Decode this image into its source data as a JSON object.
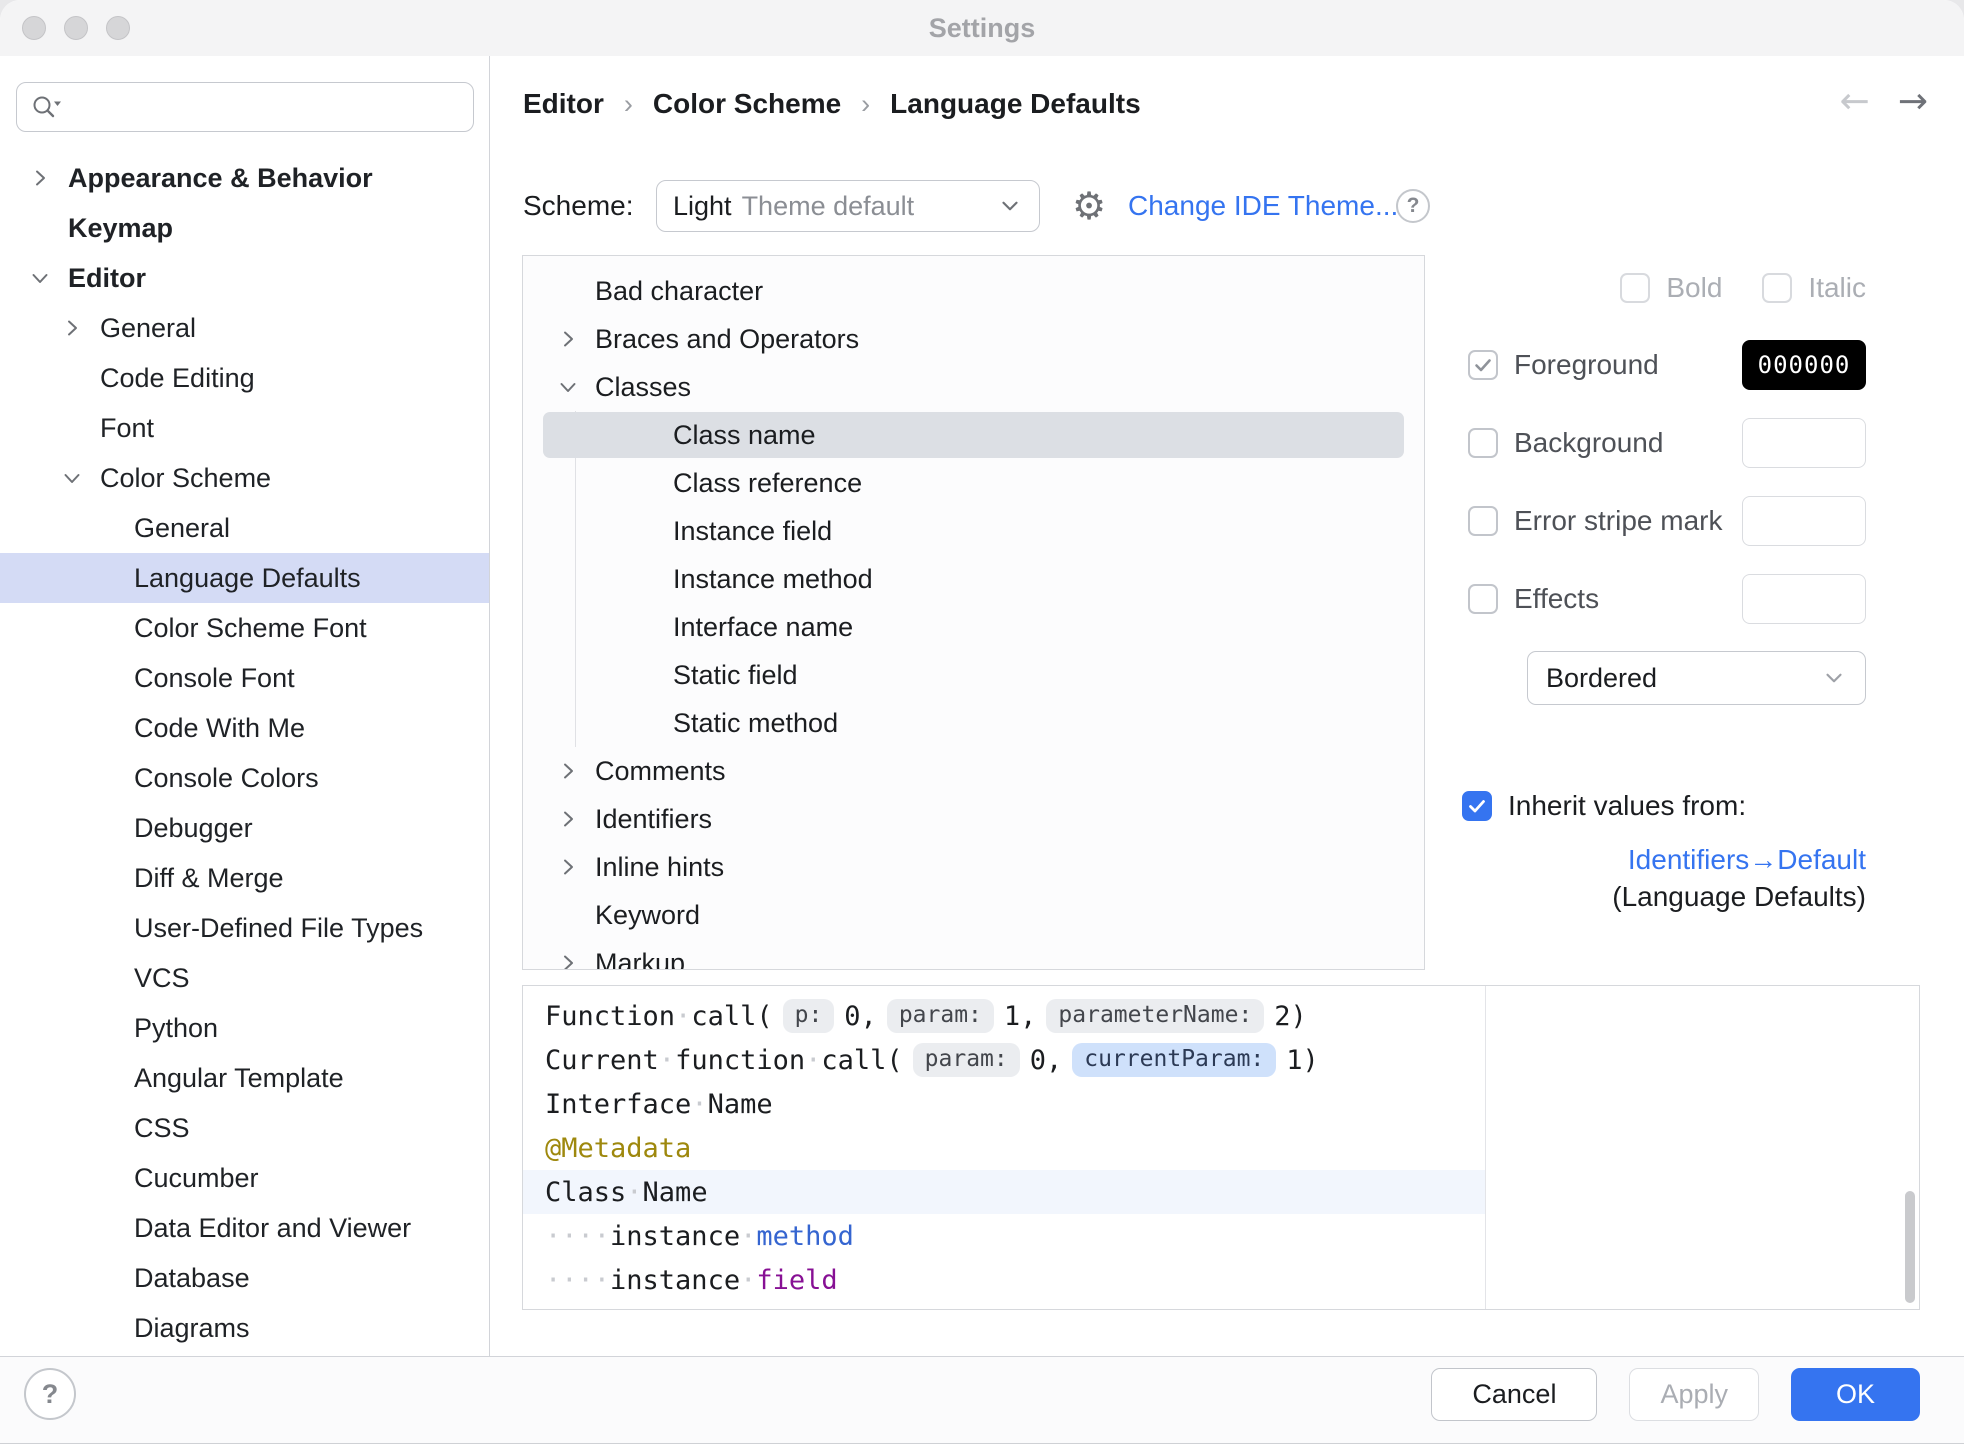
{
  "window": {
    "title": "Settings"
  },
  "misc": {
    "help_glyph": "?"
  },
  "sidebar": {
    "search": {
      "placeholder": ""
    },
    "items": [
      {
        "label": "Appearance & Behavior",
        "level": 0,
        "chevron": "right",
        "bold": true
      },
      {
        "label": "Keymap",
        "level": 0,
        "chevron": "none",
        "bold": true
      },
      {
        "label": "Editor",
        "level": 0,
        "chevron": "down",
        "bold": true
      },
      {
        "label": "General",
        "level": 1,
        "chevron": "right",
        "bold": false
      },
      {
        "label": "Code Editing",
        "level": 1,
        "chevron": "none",
        "bold": false
      },
      {
        "label": "Font",
        "level": 1,
        "chevron": "none",
        "bold": false
      },
      {
        "label": "Color Scheme",
        "level": 1,
        "chevron": "down",
        "bold": false
      },
      {
        "label": "General",
        "level": 2,
        "chevron": "none",
        "bold": false
      },
      {
        "label": "Language Defaults",
        "level": 2,
        "chevron": "none",
        "bold": false,
        "selected": true
      },
      {
        "label": "Color Scheme Font",
        "level": 2,
        "chevron": "none",
        "bold": false
      },
      {
        "label": "Console Font",
        "level": 2,
        "chevron": "none",
        "bold": false
      },
      {
        "label": "Code With Me",
        "level": 2,
        "chevron": "none",
        "bold": false
      },
      {
        "label": "Console Colors",
        "level": 2,
        "chevron": "none",
        "bold": false
      },
      {
        "label": "Debugger",
        "level": 2,
        "chevron": "none",
        "bold": false
      },
      {
        "label": "Diff & Merge",
        "level": 2,
        "chevron": "none",
        "bold": false
      },
      {
        "label": "User-Defined File Types",
        "level": 2,
        "chevron": "none",
        "bold": false
      },
      {
        "label": "VCS",
        "level": 2,
        "chevron": "none",
        "bold": false
      },
      {
        "label": "Python",
        "level": 2,
        "chevron": "none",
        "bold": false
      },
      {
        "label": "Angular Template",
        "level": 2,
        "chevron": "none",
        "bold": false
      },
      {
        "label": "CSS",
        "level": 2,
        "chevron": "none",
        "bold": false
      },
      {
        "label": "Cucumber",
        "level": 2,
        "chevron": "none",
        "bold": false
      },
      {
        "label": "Data Editor and Viewer",
        "level": 2,
        "chevron": "none",
        "bold": false
      },
      {
        "label": "Database",
        "level": 2,
        "chevron": "none",
        "bold": false
      },
      {
        "label": "Diagrams",
        "level": 2,
        "chevron": "none",
        "bold": false
      }
    ]
  },
  "header": {
    "breadcrumb": [
      "Editor",
      "Color Scheme",
      "Language Defaults"
    ],
    "separator": "›",
    "scheme_label": "Scheme:",
    "scheme_value": "Light",
    "scheme_value_suffix": "Theme default",
    "change_theme_link": "Change IDE Theme..."
  },
  "tree": {
    "items": [
      {
        "label": "Bad character",
        "level": 0,
        "chevron": "none"
      },
      {
        "label": "Braces and Operators",
        "level": 0,
        "chevron": "right"
      },
      {
        "label": "Classes",
        "level": 0,
        "chevron": "down"
      },
      {
        "label": "Class name",
        "level": 1,
        "chevron": "none",
        "selected": true
      },
      {
        "label": "Class reference",
        "level": 1,
        "chevron": "none"
      },
      {
        "label": "Instance field",
        "level": 1,
        "chevron": "none"
      },
      {
        "label": "Instance method",
        "level": 1,
        "chevron": "none"
      },
      {
        "label": "Interface name",
        "level": 1,
        "chevron": "none"
      },
      {
        "label": "Static field",
        "level": 1,
        "chevron": "none"
      },
      {
        "label": "Static method",
        "level": 1,
        "chevron": "none"
      },
      {
        "label": "Comments",
        "level": 0,
        "chevron": "right"
      },
      {
        "label": "Identifiers",
        "level": 0,
        "chevron": "right"
      },
      {
        "label": "Inline hints",
        "level": 0,
        "chevron": "right"
      },
      {
        "label": "Keyword",
        "level": 0,
        "chevron": "none"
      },
      {
        "label": "Markup",
        "level": 0,
        "chevron": "right"
      }
    ]
  },
  "options": {
    "bold_label": "Bold",
    "italic_label": "Italic",
    "foreground": {
      "label": "Foreground",
      "checked": true,
      "value": "000000",
      "swatch": "#000000"
    },
    "background": {
      "label": "Background",
      "checked": false
    },
    "error_stripe": {
      "label": "Error stripe mark",
      "checked": false
    },
    "effects": {
      "label": "Effects",
      "checked": false
    },
    "effects_style": "Bordered",
    "inherit": {
      "label": "Inherit values from:",
      "checked": true,
      "link": "Identifiers→Default",
      "context": "(Language Defaults)"
    }
  },
  "preview": {
    "lines": [
      {
        "segments": [
          {
            "t": "Function",
            "c": "code"
          },
          {
            "t": "·",
            "c": "ws"
          },
          {
            "t": "call(",
            "c": "code"
          },
          {
            "t": "p:",
            "c": "chip"
          },
          {
            "t": "0,",
            "c": "code"
          },
          {
            "t": "param:",
            "c": "chip"
          },
          {
            "t": "1,",
            "c": "code"
          },
          {
            "t": "parameterName:",
            "c": "chip"
          },
          {
            "t": "2)",
            "c": "code"
          }
        ]
      },
      {
        "segments": [
          {
            "t": "Current",
            "c": "code"
          },
          {
            "t": "·",
            "c": "ws"
          },
          {
            "t": "function",
            "c": "code"
          },
          {
            "t": "·",
            "c": "ws"
          },
          {
            "t": "call(",
            "c": "code"
          },
          {
            "t": "param:",
            "c": "chip"
          },
          {
            "t": "0,",
            "c": "code"
          },
          {
            "t": "currentParam:",
            "c": "chip-blue"
          },
          {
            "t": "1)",
            "c": "code"
          }
        ]
      },
      {
        "segments": [
          {
            "t": "Interface",
            "c": "code"
          },
          {
            "t": "·",
            "c": "ws"
          },
          {
            "t": "Name",
            "c": "code"
          }
        ]
      },
      {
        "segments": [
          {
            "t": "@Metadata",
            "c": "metadata"
          }
        ]
      },
      {
        "highlight": true,
        "segments": [
          {
            "t": "Class",
            "c": "code"
          },
          {
            "t": "·",
            "c": "ws"
          },
          {
            "t": "Name",
            "c": "code"
          }
        ]
      },
      {
        "segments": [
          {
            "t": "····",
            "c": "ws"
          },
          {
            "t": "instance",
            "c": "code"
          },
          {
            "t": "·",
            "c": "ws"
          },
          {
            "t": "method",
            "c": "method"
          }
        ]
      },
      {
        "segments": [
          {
            "t": "····",
            "c": "ws"
          },
          {
            "t": "instance",
            "c": "code"
          },
          {
            "t": "·",
            "c": "ws"
          },
          {
            "t": "field",
            "c": "field"
          }
        ]
      }
    ]
  },
  "footer": {
    "cancel": "Cancel",
    "apply": "Apply",
    "ok": "OK"
  },
  "colors": {
    "accent": "#3574f0",
    "link": "#3574f0",
    "sidebar_selection": "#d4dbf5",
    "tree_selection": "#dcdfe4",
    "foreground_swatch": "#000000",
    "metadata_text": "#9e880d",
    "method_text": "#3565d0",
    "field_text": "#871094"
  }
}
